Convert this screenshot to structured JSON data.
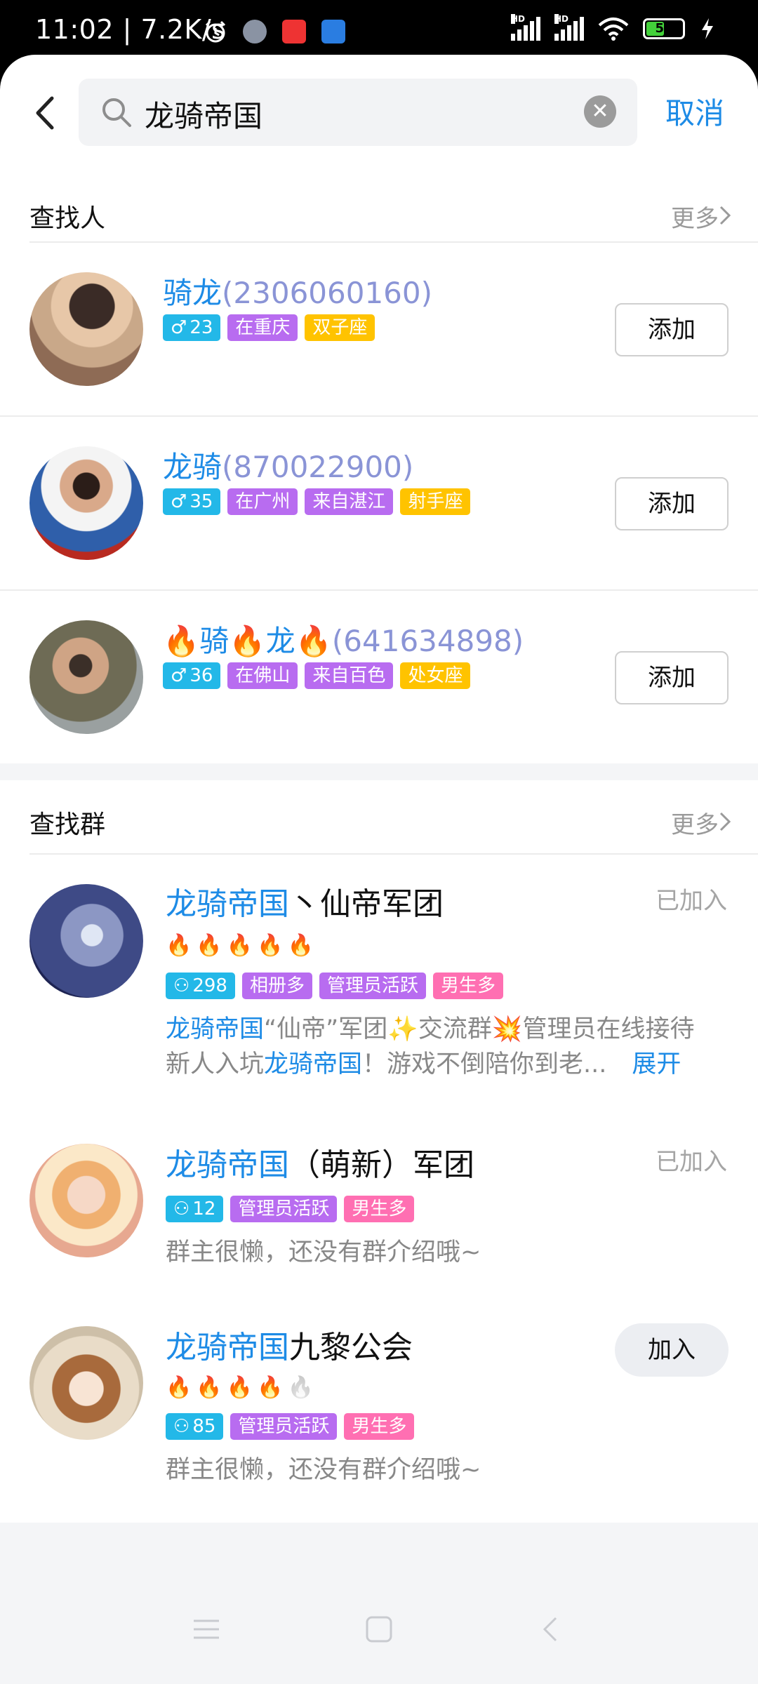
{
  "status_bar": {
    "time_speed": "11:02 | 7.2K/s",
    "hd1": "HD",
    "hd2": "HD",
    "battery": "50",
    "battery_level": 0.5
  },
  "search": {
    "query": "龙骑帝国",
    "cancel": "取消"
  },
  "people_section": {
    "title": "查找人",
    "more": "更多",
    "items": [
      {
        "name_hl": "骑龙",
        "name_rest": "(2306060160)",
        "age": "23",
        "tags": [
          "在重庆",
          "双子座"
        ]
      },
      {
        "name_hl": "龙骑",
        "name_rest": "(870022900)",
        "age": "35",
        "tags": [
          "在广州",
          "来自湛江",
          "射手座"
        ]
      },
      {
        "name_pre": "🔥骑🔥龙🔥",
        "name_rest": "(641634898)",
        "age": "36",
        "tags": [
          "在佛山",
          "来自百色",
          "处女座"
        ]
      }
    ],
    "add_label": "添加"
  },
  "groups_section": {
    "title": "查找群",
    "more": "更多",
    "items": [
      {
        "name_hl": "龙骑帝国",
        "name_rest": "丶仙帝军团",
        "status": "已加入",
        "fires": 5,
        "fires_total": 5,
        "members": "298",
        "tags": [
          "相册多",
          "管理员活跃",
          "男生多"
        ],
        "desc_hl1": "龙骑帝国",
        "desc_a": "“仙帝”军团✨交流群💥管理员在线接待",
        "desc_b": "新人入坑",
        "desc_hl2": "龙骑帝国",
        "desc_c": "！游戏不倒陪你到老...",
        "expand": "展开"
      },
      {
        "name_hl": "龙骑帝国",
        "name_rest": "（萌新）军团",
        "status": "已加入",
        "members": "12",
        "tags": [
          "管理员活跃",
          "男生多"
        ],
        "desc": "群主很懒，还没有群介绍哦~"
      },
      {
        "name_hl": "龙骑帝国",
        "name_rest": "九黎公会",
        "button": "加入",
        "fires": 4,
        "fires_total": 5,
        "members": "85",
        "tags": [
          "管理员活跃",
          "男生多"
        ],
        "desc": "群主很懒，还没有群介绍哦~"
      }
    ]
  },
  "colors": {
    "accent": "#1d8be6",
    "tag_blue": "#23b8e8",
    "tag_purple": "#b86cf0",
    "tag_yellow": "#ffc300",
    "tag_pink": "#ff6fb2"
  },
  "icons": [
    "back-arrow-icon",
    "search-icon",
    "clear-icon",
    "chevron-right-icon",
    "male-icon",
    "person-icon",
    "fire-icon",
    "menu-nav-icon",
    "home-nav-icon",
    "back-nav-icon"
  ]
}
